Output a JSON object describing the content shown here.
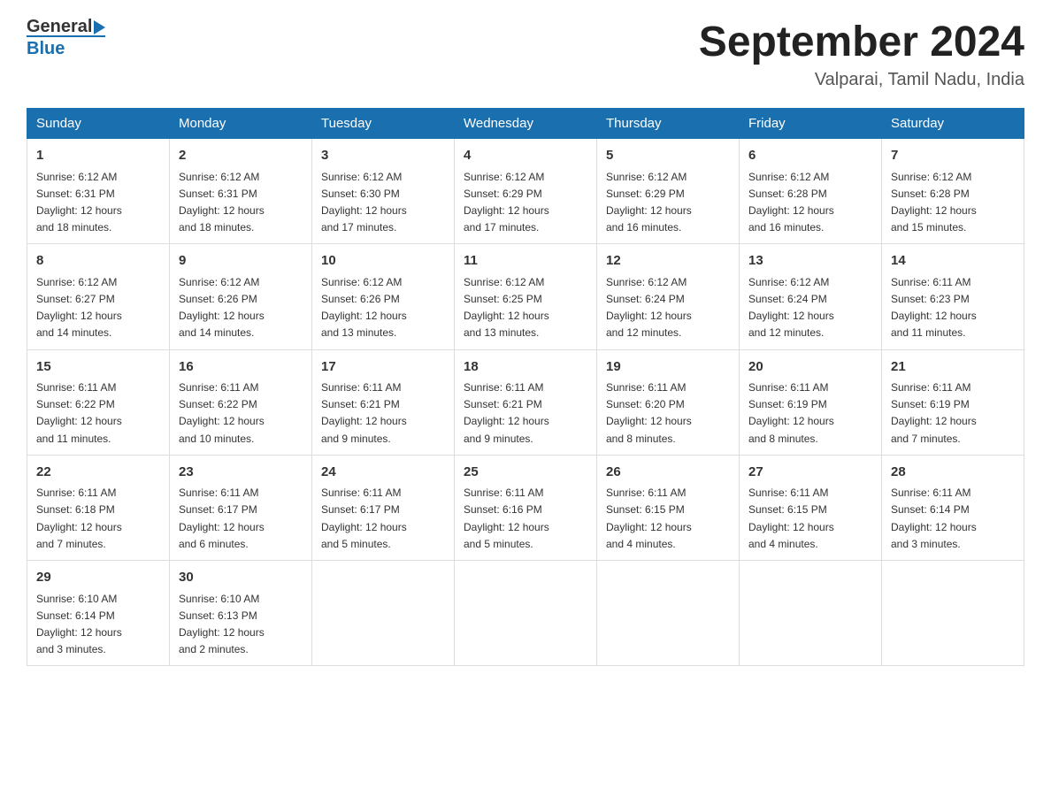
{
  "header": {
    "logo_general": "General",
    "logo_blue": "Blue",
    "month_title": "September 2024",
    "location": "Valparai, Tamil Nadu, India"
  },
  "days_of_week": [
    "Sunday",
    "Monday",
    "Tuesday",
    "Wednesday",
    "Thursday",
    "Friday",
    "Saturday"
  ],
  "weeks": [
    [
      {
        "day": "1",
        "sunrise": "6:12 AM",
        "sunset": "6:31 PM",
        "daylight": "12 hours and 18 minutes."
      },
      {
        "day": "2",
        "sunrise": "6:12 AM",
        "sunset": "6:31 PM",
        "daylight": "12 hours and 18 minutes."
      },
      {
        "day": "3",
        "sunrise": "6:12 AM",
        "sunset": "6:30 PM",
        "daylight": "12 hours and 17 minutes."
      },
      {
        "day": "4",
        "sunrise": "6:12 AM",
        "sunset": "6:29 PM",
        "daylight": "12 hours and 17 minutes."
      },
      {
        "day": "5",
        "sunrise": "6:12 AM",
        "sunset": "6:29 PM",
        "daylight": "12 hours and 16 minutes."
      },
      {
        "day": "6",
        "sunrise": "6:12 AM",
        "sunset": "6:28 PM",
        "daylight": "12 hours and 16 minutes."
      },
      {
        "day": "7",
        "sunrise": "6:12 AM",
        "sunset": "6:28 PM",
        "daylight": "12 hours and 15 minutes."
      }
    ],
    [
      {
        "day": "8",
        "sunrise": "6:12 AM",
        "sunset": "6:27 PM",
        "daylight": "12 hours and 14 minutes."
      },
      {
        "day": "9",
        "sunrise": "6:12 AM",
        "sunset": "6:26 PM",
        "daylight": "12 hours and 14 minutes."
      },
      {
        "day": "10",
        "sunrise": "6:12 AM",
        "sunset": "6:26 PM",
        "daylight": "12 hours and 13 minutes."
      },
      {
        "day": "11",
        "sunrise": "6:12 AM",
        "sunset": "6:25 PM",
        "daylight": "12 hours and 13 minutes."
      },
      {
        "day": "12",
        "sunrise": "6:12 AM",
        "sunset": "6:24 PM",
        "daylight": "12 hours and 12 minutes."
      },
      {
        "day": "13",
        "sunrise": "6:12 AM",
        "sunset": "6:24 PM",
        "daylight": "12 hours and 12 minutes."
      },
      {
        "day": "14",
        "sunrise": "6:11 AM",
        "sunset": "6:23 PM",
        "daylight": "12 hours and 11 minutes."
      }
    ],
    [
      {
        "day": "15",
        "sunrise": "6:11 AM",
        "sunset": "6:22 PM",
        "daylight": "12 hours and 11 minutes."
      },
      {
        "day": "16",
        "sunrise": "6:11 AM",
        "sunset": "6:22 PM",
        "daylight": "12 hours and 10 minutes."
      },
      {
        "day": "17",
        "sunrise": "6:11 AM",
        "sunset": "6:21 PM",
        "daylight": "12 hours and 9 minutes."
      },
      {
        "day": "18",
        "sunrise": "6:11 AM",
        "sunset": "6:21 PM",
        "daylight": "12 hours and 9 minutes."
      },
      {
        "day": "19",
        "sunrise": "6:11 AM",
        "sunset": "6:20 PM",
        "daylight": "12 hours and 8 minutes."
      },
      {
        "day": "20",
        "sunrise": "6:11 AM",
        "sunset": "6:19 PM",
        "daylight": "12 hours and 8 minutes."
      },
      {
        "day": "21",
        "sunrise": "6:11 AM",
        "sunset": "6:19 PM",
        "daylight": "12 hours and 7 minutes."
      }
    ],
    [
      {
        "day": "22",
        "sunrise": "6:11 AM",
        "sunset": "6:18 PM",
        "daylight": "12 hours and 7 minutes."
      },
      {
        "day": "23",
        "sunrise": "6:11 AM",
        "sunset": "6:17 PM",
        "daylight": "12 hours and 6 minutes."
      },
      {
        "day": "24",
        "sunrise": "6:11 AM",
        "sunset": "6:17 PM",
        "daylight": "12 hours and 5 minutes."
      },
      {
        "day": "25",
        "sunrise": "6:11 AM",
        "sunset": "6:16 PM",
        "daylight": "12 hours and 5 minutes."
      },
      {
        "day": "26",
        "sunrise": "6:11 AM",
        "sunset": "6:15 PM",
        "daylight": "12 hours and 4 minutes."
      },
      {
        "day": "27",
        "sunrise": "6:11 AM",
        "sunset": "6:15 PM",
        "daylight": "12 hours and 4 minutes."
      },
      {
        "day": "28",
        "sunrise": "6:11 AM",
        "sunset": "6:14 PM",
        "daylight": "12 hours and 3 minutes."
      }
    ],
    [
      {
        "day": "29",
        "sunrise": "6:10 AM",
        "sunset": "6:14 PM",
        "daylight": "12 hours and 3 minutes."
      },
      {
        "day": "30",
        "sunrise": "6:10 AM",
        "sunset": "6:13 PM",
        "daylight": "12 hours and 2 minutes."
      },
      null,
      null,
      null,
      null,
      null
    ]
  ],
  "labels": {
    "sunrise": "Sunrise:",
    "sunset": "Sunset:",
    "daylight": "Daylight:"
  }
}
